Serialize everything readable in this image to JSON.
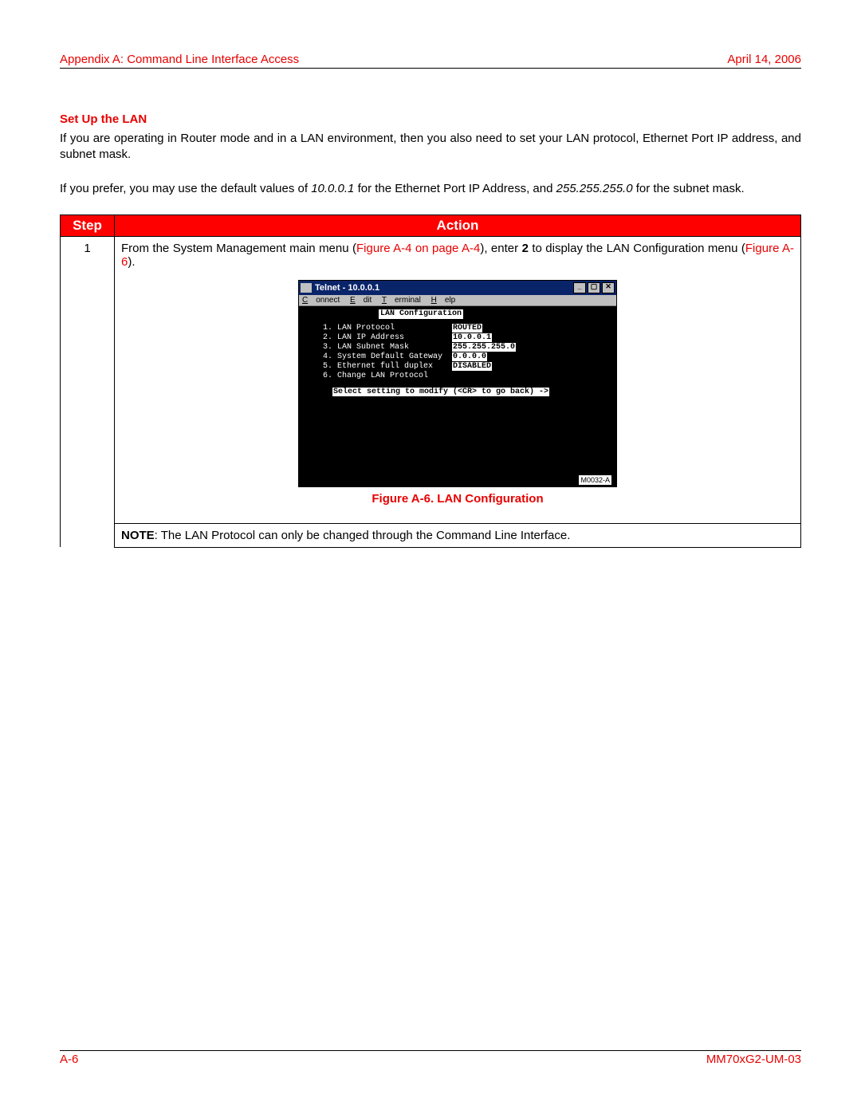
{
  "header": {
    "left": "Appendix A: Command Line Interface Access",
    "right": "April 14, 2006"
  },
  "section_title": "Set Up the LAN",
  "para1_a": "If you are operating in Router mode and in a LAN environment, then you also need to set your LAN protocol, Ethernet Port IP address, and subnet mask.",
  "para2_a": "If you prefer, you may use the default values of ",
  "para2_ip": "10.0.0.1",
  "para2_b": " for the Ethernet Port IP Address, and ",
  "para2_mask": "255.255.255.0",
  "para2_c": " for the subnet mask.",
  "table": {
    "h_step": "Step",
    "h_action": "Action",
    "step1_num": "1",
    "step1_a": "From  the  System  Management  main  menu  (",
    "step1_link1": "Figure  A-4  on  page A-4",
    "step1_b": "),  enter ",
    "step1_bold": "2",
    "step1_c": "  to  display  the  LAN Configuration menu (",
    "step1_link2": "Figure A-6",
    "step1_d": ")."
  },
  "telnet": {
    "title": "Telnet - 10.0.0.1",
    "menu_connect": "Connect",
    "menu_edit": "Edit",
    "menu_terminal": "Terminal",
    "menu_help": "Help",
    "screen_title": "LAN Configuration",
    "rows": [
      {
        "label": "1. LAN Protocol",
        "value": "ROUTED"
      },
      {
        "label": "2. LAN IP Address",
        "value": "10.0.0.1"
      },
      {
        "label": "3. LAN Subnet Mask",
        "value": "255.255.255.0"
      },
      {
        "label": "4. System Default Gateway",
        "value": "0.0.0.0"
      },
      {
        "label": "5. Ethernet full duplex",
        "value": "DISABLED"
      },
      {
        "label": "6. Change LAN Protocol",
        "value": ""
      }
    ],
    "prompt": "Select setting to modify (<CR> to go back) ->",
    "fig_id": "M0032-A"
  },
  "figure_caption": "Figure A-6. LAN Configuration",
  "note_bold": "NOTE",
  "note_text": ": The LAN Protocol can only be changed through the Command Line Interface.",
  "footer": {
    "left": "A-6",
    "right": "MM70xG2-UM-03"
  }
}
